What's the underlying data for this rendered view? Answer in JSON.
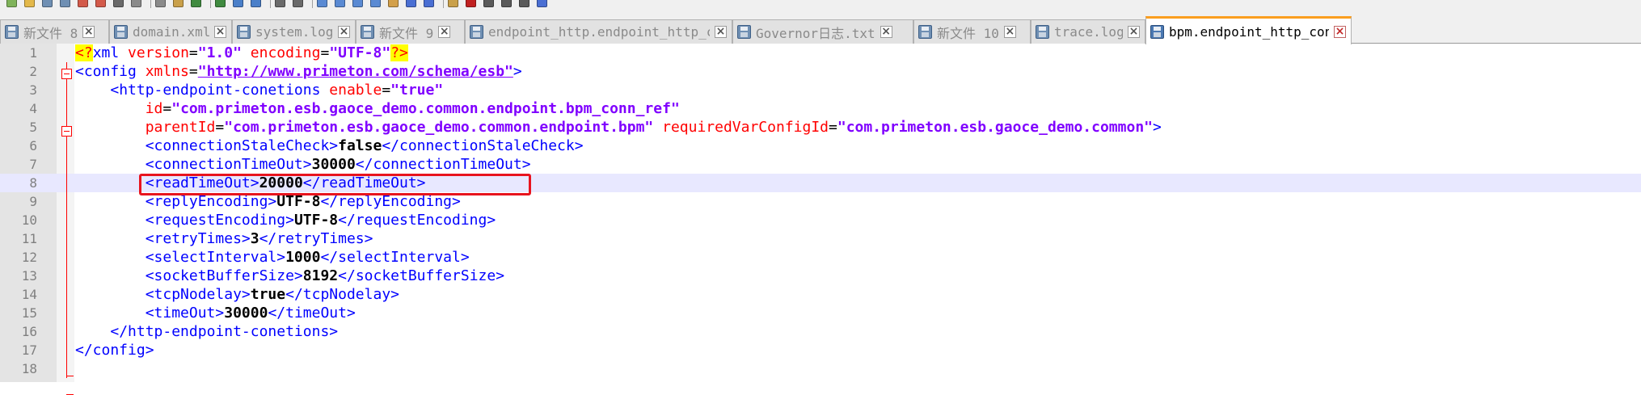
{
  "toolbar": {
    "icons": [
      "new-file-icon",
      "open-file-icon",
      "save-icon",
      "save-all-icon",
      "close-icon",
      "close-all-icon",
      "print-icon",
      "cut-icon",
      "copy-icon",
      "paste-icon",
      "undo-icon",
      "redo-icon",
      "find-icon",
      "replace-icon",
      "zoom-in-icon",
      "zoom-out-icon",
      "sync-scroll-icon",
      "word-wrap-icon",
      "show-all-chars-icon",
      "indent-guide-icon",
      "language-icon",
      "doc-map-icon",
      "function-list-icon",
      "folder-workspace-icon",
      "record-macro-icon",
      "stop-macro-icon",
      "play-macro-icon",
      "run-macro-icon",
      "save-macro-icon"
    ]
  },
  "tabs": [
    {
      "label": "新文件 8",
      "active": false
    },
    {
      "label": "domain.xml",
      "active": false
    },
    {
      "label": "system.log",
      "active": false
    },
    {
      "label": "新文件 9",
      "active": false
    },
    {
      "label": "endpoint_http.endpoint_http_conn",
      "active": false
    },
    {
      "label": "Governor日志.txt",
      "active": false
    },
    {
      "label": "新文件 10",
      "active": false
    },
    {
      "label": "trace.log",
      "active": false
    },
    {
      "label": "bpm.endpoint_http_conn",
      "active": true
    }
  ],
  "editor": {
    "current_line": 8,
    "lines": [
      {
        "n": "1",
        "tokens": [
          [
            "pi",
            "<?"
          ],
          [
            "tag",
            "xml "
          ],
          [
            "attr",
            "version"
          ],
          [
            "",
            "="
          ],
          [
            "val",
            "\"1.0\""
          ],
          [
            "attr",
            " encoding"
          ],
          [
            "",
            "="
          ],
          [
            "val",
            "\"UTF-8\""
          ],
          [
            "pi",
            "?>"
          ]
        ]
      },
      {
        "n": "2",
        "tokens": [
          [
            "tag",
            "<config "
          ],
          [
            "attr",
            "xmlns"
          ],
          [
            "",
            "="
          ],
          [
            "url",
            "\"http://www.primeton.com/schema/esb\""
          ],
          [
            "tag",
            ">"
          ]
        ]
      },
      {
        "n": "3",
        "tokens": [
          [
            "",
            "    "
          ],
          [
            "tag",
            "<http-endpoint-conetions "
          ],
          [
            "attr",
            "enable"
          ],
          [
            "",
            "="
          ],
          [
            "val",
            "\"true\""
          ]
        ]
      },
      {
        "n": "4",
        "tokens": [
          [
            "",
            "        "
          ],
          [
            "attr",
            "id"
          ],
          [
            "",
            "="
          ],
          [
            "val",
            "\"com.primeton.esb.gaoce_demo.common.endpoint.bpm_conn_ref\""
          ]
        ]
      },
      {
        "n": "5",
        "tokens": [
          [
            "",
            "        "
          ],
          [
            "attr",
            "parentId"
          ],
          [
            "",
            "="
          ],
          [
            "val",
            "\"com.primeton.esb.gaoce_demo.common.endpoint.bpm\""
          ],
          [
            "attr",
            " requiredVarConfigId"
          ],
          [
            "",
            "="
          ],
          [
            "val",
            "\"com.primeton.esb.gaoce_demo.common\""
          ],
          [
            "tag",
            ">"
          ]
        ]
      },
      {
        "n": "6",
        "tokens": [
          [
            "",
            "        "
          ],
          [
            "tag",
            "<connectionStaleCheck>"
          ],
          [
            "txt",
            "false"
          ],
          [
            "tag",
            "</connectionStaleCheck>"
          ]
        ]
      },
      {
        "n": "7",
        "tokens": [
          [
            "",
            "        "
          ],
          [
            "tag",
            "<connectionTimeOut>"
          ],
          [
            "txt",
            "30000"
          ],
          [
            "tag",
            "</connectionTimeOut>"
          ]
        ]
      },
      {
        "n": "8",
        "tokens": [
          [
            "",
            "        "
          ],
          [
            "tag",
            "<readTimeOut>"
          ],
          [
            "txt",
            "20000"
          ],
          [
            "tag",
            "</readTimeOut>"
          ]
        ]
      },
      {
        "n": "9",
        "tokens": [
          [
            "",
            "        "
          ],
          [
            "tag",
            "<replyEncoding>"
          ],
          [
            "txt",
            "UTF-8"
          ],
          [
            "tag",
            "</replyEncoding>"
          ]
        ]
      },
      {
        "n": "10",
        "tokens": [
          [
            "",
            "        "
          ],
          [
            "tag",
            "<requestEncoding>"
          ],
          [
            "txt",
            "UTF-8"
          ],
          [
            "tag",
            "</requestEncoding>"
          ]
        ]
      },
      {
        "n": "11",
        "tokens": [
          [
            "",
            "        "
          ],
          [
            "tag",
            "<retryTimes>"
          ],
          [
            "txt",
            "3"
          ],
          [
            "tag",
            "</retryTimes>"
          ]
        ]
      },
      {
        "n": "12",
        "tokens": [
          [
            "",
            "        "
          ],
          [
            "tag",
            "<selectInterval>"
          ],
          [
            "txt",
            "1000"
          ],
          [
            "tag",
            "</selectInterval>"
          ]
        ]
      },
      {
        "n": "13",
        "tokens": [
          [
            "",
            "        "
          ],
          [
            "tag",
            "<socketBufferSize>"
          ],
          [
            "txt",
            "8192"
          ],
          [
            "tag",
            "</socketBufferSize>"
          ]
        ]
      },
      {
        "n": "14",
        "tokens": [
          [
            "",
            "        "
          ],
          [
            "tag",
            "<tcpNodelay>"
          ],
          [
            "txt",
            "true"
          ],
          [
            "tag",
            "</tcpNodelay>"
          ]
        ]
      },
      {
        "n": "15",
        "tokens": [
          [
            "",
            "        "
          ],
          [
            "tag",
            "<timeOut>"
          ],
          [
            "txt",
            "30000"
          ],
          [
            "tag",
            "</timeOut>"
          ]
        ]
      },
      {
        "n": "16",
        "tokens": [
          [
            "",
            "    "
          ],
          [
            "tag",
            "</http-endpoint-conetions>"
          ]
        ]
      },
      {
        "n": "17",
        "tokens": [
          [
            "tag",
            "</config>"
          ]
        ]
      },
      {
        "n": "18",
        "tokens": []
      }
    ]
  },
  "annotation": {
    "color": "#e8141e",
    "target_line": 8
  }
}
